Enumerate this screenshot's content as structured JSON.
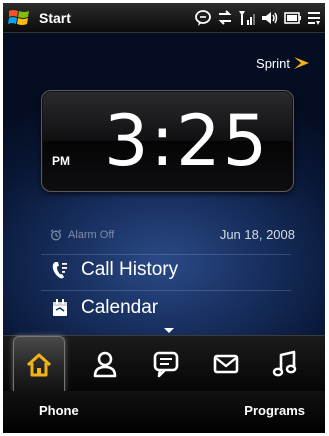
{
  "status_bar": {
    "start_label": "Start",
    "icons": [
      "windows-logo-icon",
      "message-icon",
      "data-sync-icon",
      "signal-icon",
      "volume-icon",
      "battery-icon",
      "menu-icon"
    ]
  },
  "home": {
    "carrier": "Sprint",
    "clock": {
      "time": "3:25",
      "ampm": "PM"
    },
    "alarm": "Alarm Off",
    "date": "Jun 18, 2008",
    "items": [
      {
        "label": "Call History",
        "icon": "call-history-icon"
      },
      {
        "label": "Calendar",
        "icon": "calendar-icon"
      }
    ]
  },
  "tabs": [
    {
      "name": "home",
      "icon": "home-icon",
      "active": true
    },
    {
      "name": "people",
      "icon": "person-icon",
      "active": false
    },
    {
      "name": "messages",
      "icon": "sms-icon",
      "active": false
    },
    {
      "name": "email",
      "icon": "envelope-icon",
      "active": false
    },
    {
      "name": "music",
      "icon": "music-note-icon",
      "active": false
    }
  ],
  "softkeys": {
    "left": "Phone",
    "right": "Programs"
  },
  "colors": {
    "active_tab_icon": "#f0b419",
    "inactive_tab_icon": "#ffffff",
    "carrier_accent": "#f0b419"
  }
}
